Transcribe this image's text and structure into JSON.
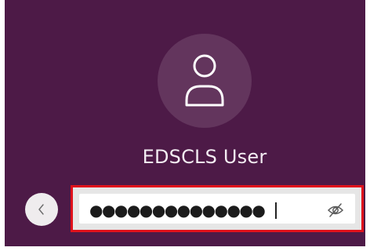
{
  "user": {
    "name": "EDSCLS User",
    "avatar_icon": "user-icon"
  },
  "login": {
    "back_icon": "chevron-left-icon",
    "password_masked": "●●●●●●●●●●●●●●",
    "reveal_icon": "eye-slash-icon",
    "highlight_color": "#e0121c"
  },
  "colors": {
    "background": "#4d1a47",
    "avatar_circle": "#63355d",
    "text": "#f3ecf2"
  }
}
